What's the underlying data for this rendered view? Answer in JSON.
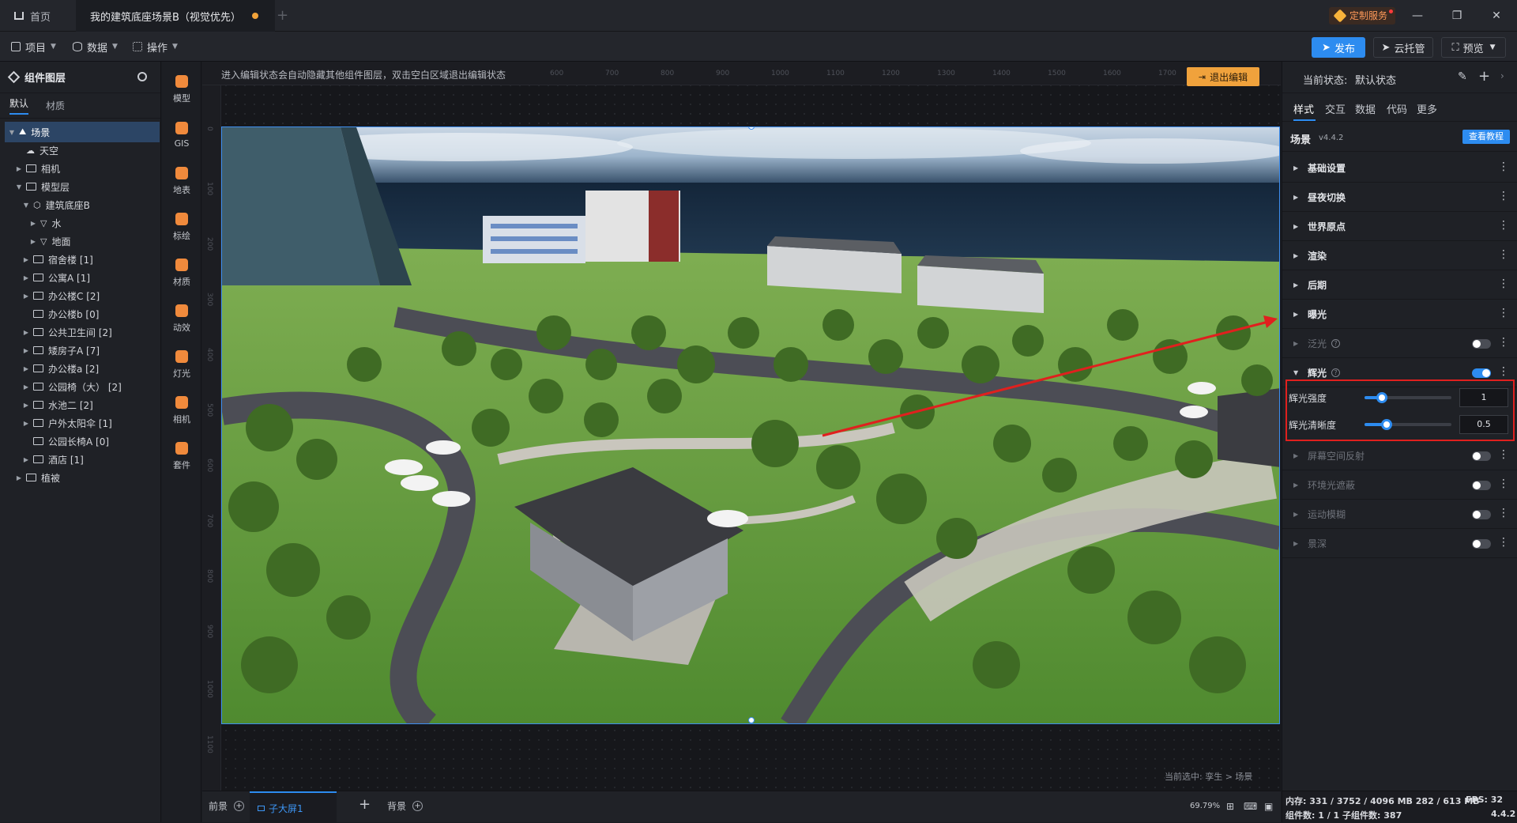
{
  "titlebar": {
    "home_tab": "首页",
    "project_tab": "我的建筑底座场景B（视觉优先）",
    "custom_service": "定制服务"
  },
  "toolbar": {
    "project": "项目",
    "data": "数据",
    "operate": "操作",
    "publish": "发布",
    "cloud": "云托管",
    "preview": "预览"
  },
  "left": {
    "title": "组件图层",
    "tab_default": "默认",
    "tab_material": "材质",
    "tree": [
      {
        "label": "场景",
        "indent": 0,
        "arrow": "▼",
        "icon": "scene",
        "selected": true
      },
      {
        "label": "天空",
        "indent": 1,
        "arrow": "",
        "icon": "sky"
      },
      {
        "label": "相机",
        "indent": 1,
        "arrow": "▶",
        "icon": "folder"
      },
      {
        "label": "模型层",
        "indent": 1,
        "arrow": "▼",
        "icon": "folder"
      },
      {
        "label": "建筑底座B",
        "indent": 2,
        "arrow": "▼",
        "icon": "cube"
      },
      {
        "label": "水",
        "indent": 3,
        "arrow": "▶",
        "icon": "tri"
      },
      {
        "label": "地面",
        "indent": 3,
        "arrow": "▶",
        "icon": "tri"
      },
      {
        "label": "宿舍楼 [1]",
        "indent": 2,
        "arrow": "▶",
        "icon": "folder"
      },
      {
        "label": "公寓A [1]",
        "indent": 2,
        "arrow": "▶",
        "icon": "folder"
      },
      {
        "label": "办公楼C [2]",
        "indent": 2,
        "arrow": "▶",
        "icon": "folder"
      },
      {
        "label": "办公楼b [0]",
        "indent": 2,
        "arrow": "",
        "icon": "folder"
      },
      {
        "label": "公共卫生间 [2]",
        "indent": 2,
        "arrow": "▶",
        "icon": "folder"
      },
      {
        "label": "矮房子A [7]",
        "indent": 2,
        "arrow": "▶",
        "icon": "folder"
      },
      {
        "label": "办公楼a [2]",
        "indent": 2,
        "arrow": "▶",
        "icon": "folder"
      },
      {
        "label": "公园椅（大） [2]",
        "indent": 2,
        "arrow": "▶",
        "icon": "folder"
      },
      {
        "label": "水池二 [2]",
        "indent": 2,
        "arrow": "▶",
        "icon": "folder"
      },
      {
        "label": "户外太阳伞 [1]",
        "indent": 2,
        "arrow": "▶",
        "icon": "folder"
      },
      {
        "label": "公园长椅A [0]",
        "indent": 2,
        "arrow": "",
        "icon": "folder"
      },
      {
        "label": "酒店 [1]",
        "indent": 2,
        "arrow": "▶",
        "icon": "folder"
      },
      {
        "label": "植被",
        "indent": 1,
        "arrow": "▶",
        "icon": "folder"
      }
    ]
  },
  "tools": [
    "模型",
    "GIS",
    "地表",
    "标绘",
    "材质",
    "动效",
    "灯光",
    "相机",
    "套件"
  ],
  "canvas": {
    "hint": "进入编辑状态会自动隐藏其他组件图层，双击空白区域退出编辑状态",
    "exit_edit": "退出编辑",
    "current_selection": "当前选中: 孪生 > 场景",
    "ruler_top": [
      "600",
      "700",
      "800",
      "900",
      "1000",
      "1100",
      "1200",
      "1300",
      "1400",
      "1500",
      "1600",
      "1700"
    ],
    "ruler_left": [
      "0",
      "100",
      "200",
      "300",
      "400",
      "500",
      "600",
      "700",
      "800",
      "900",
      "1000",
      "1100"
    ]
  },
  "bottom": {
    "foreground": "前景",
    "screen_tab": "子大屏1",
    "background": "背景",
    "zoom": "69.79%"
  },
  "right": {
    "current_state_label": "当前状态:",
    "current_state_value": "默认状态",
    "tabs": [
      "样式",
      "交互",
      "数据",
      "代码",
      "更多"
    ],
    "component_name": "场景",
    "version": "v4.4.2",
    "tutorial": "查看教程",
    "sections": [
      {
        "title": "基础设置",
        "dim": false,
        "toggle": null,
        "help": false
      },
      {
        "title": "昼夜切换",
        "dim": false,
        "toggle": null,
        "help": false
      },
      {
        "title": "世界原点",
        "dim": false,
        "toggle": null,
        "help": false
      },
      {
        "title": "渲染",
        "dim": false,
        "toggle": null,
        "help": false
      },
      {
        "title": "后期",
        "dim": false,
        "toggle": null,
        "help": false
      },
      {
        "title": "曝光",
        "dim": false,
        "toggle": null,
        "help": false
      },
      {
        "title": "泛光",
        "dim": true,
        "toggle": false,
        "help": true
      },
      {
        "title": "辉光",
        "dim": false,
        "toggle": true,
        "help": true,
        "expanded": true
      }
    ],
    "glow": {
      "intensity_label": "辉光强度",
      "intensity_value": "1",
      "intensity_level": 0.2,
      "clarity_label": "辉光清晰度",
      "clarity_value": "0.5",
      "clarity_level": 0.25
    },
    "sections_after": [
      {
        "title": "屏幕空间反射",
        "toggle": false
      },
      {
        "title": "环境光遮蔽",
        "toggle": false
      },
      {
        "title": "运动模糊",
        "toggle": false
      },
      {
        "title": "景深",
        "toggle": false
      }
    ],
    "status": {
      "memory": "内存: 331 / 3752 / 4096 MB 282 / 613 MB",
      "fps": "FPS: 32",
      "components": "组件数: 1 / 1 子组件数: 387",
      "version": "4.4.2"
    }
  },
  "colors": {
    "accent": "#2d8cf0",
    "highlight_box": "#e0201e",
    "exit_button": "#f0a23c"
  }
}
